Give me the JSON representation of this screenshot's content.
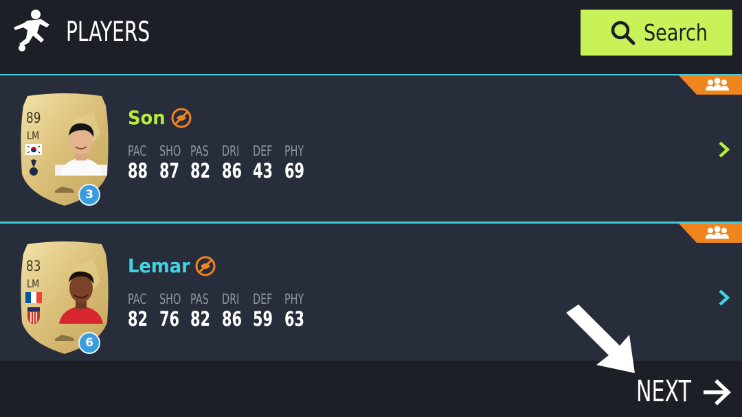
{
  "header": {
    "title": "PLAYERS",
    "icon": "soccer-player-icon",
    "search_label": "Search",
    "search_icon": "search-icon",
    "accent_color": "#c8f257"
  },
  "players": [
    {
      "name": "Son",
      "name_color": "#b7ec3f",
      "rating": "89",
      "position": "LM",
      "nation_flag": "south-korea-flag-icon",
      "club_crest": "tottenham-crest-icon",
      "badge_count": "3",
      "status_icon": "untradeable-icon",
      "tag_icon": "squad-group-icon",
      "stats": [
        {
          "label": "PAC",
          "value": "88"
        },
        {
          "label": "SHO",
          "value": "87"
        },
        {
          "label": "PAS",
          "value": "82"
        },
        {
          "label": "DRI",
          "value": "86"
        },
        {
          "label": "DEF",
          "value": "43"
        },
        {
          "label": "PHY",
          "value": "69"
        }
      ],
      "chevron_color": "#b7ec3f"
    },
    {
      "name": "Lemar",
      "name_color": "#3fd4e0",
      "rating": "83",
      "position": "LM",
      "nation_flag": "france-flag-icon",
      "club_crest": "atletico-madrid-crest-icon",
      "badge_count": "6",
      "status_icon": "untradeable-icon",
      "tag_icon": "squad-group-icon",
      "stats": [
        {
          "label": "PAC",
          "value": "82"
        },
        {
          "label": "SHO",
          "value": "76"
        },
        {
          "label": "PAS",
          "value": "82"
        },
        {
          "label": "DRI",
          "value": "86"
        },
        {
          "label": "DEF",
          "value": "59"
        },
        {
          "label": "PHY",
          "value": "63"
        }
      ],
      "chevron_color": "#3fd4e0"
    }
  ],
  "footer": {
    "next_label": "NEXT",
    "next_icon": "arrow-right-icon"
  },
  "overlay": {
    "pointer_icon": "pointer-arrow-icon"
  },
  "colors": {
    "background": "#1c1f26",
    "row_background": "#272d3a",
    "divider": "#3fcbd8",
    "tag_orange": "#f0851e",
    "stat_label": "#8d94a3"
  }
}
